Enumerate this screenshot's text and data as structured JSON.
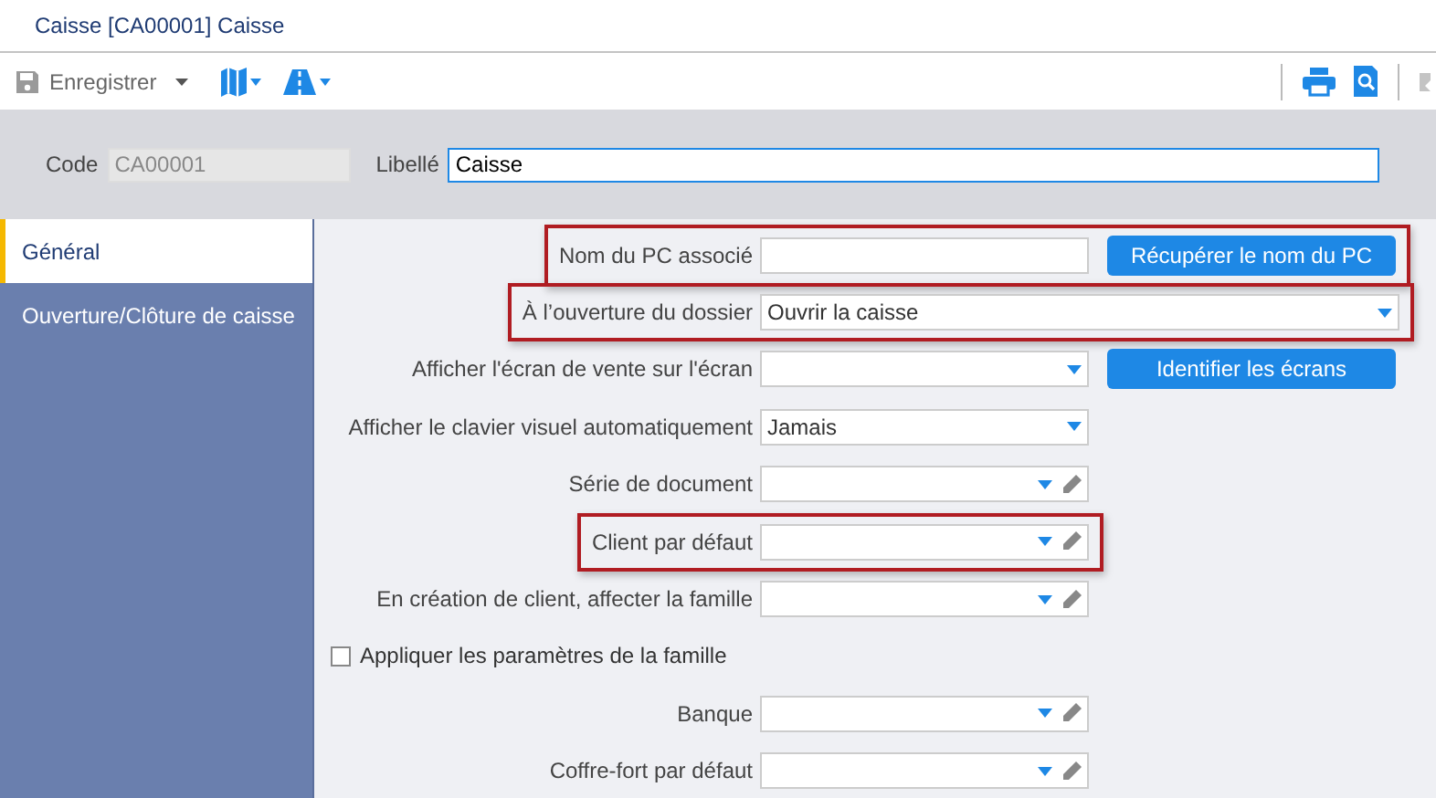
{
  "window": {
    "title": "Caisse [CA00001] Caisse"
  },
  "toolbar": {
    "save_label": "Enregistrer"
  },
  "header": {
    "code_label": "Code",
    "code_value": "CA00001",
    "libelle_label": "Libellé",
    "libelle_value": "Caisse"
  },
  "sidebar": {
    "items": [
      {
        "label": "Général",
        "selected": true
      },
      {
        "label": "Ouverture/Clôture de caisse",
        "selected": false
      }
    ]
  },
  "form": {
    "rows": [
      {
        "kind": "text",
        "label": "Nom du PC associé",
        "value": "",
        "button": "Récupérer le nom du PC",
        "highlighted": true
      },
      {
        "kind": "select-wide",
        "label": "À l’ouverture du dossier",
        "value": "Ouvrir la caisse",
        "highlighted": true
      },
      {
        "kind": "select",
        "label": "Afficher l'écran de vente sur l'écran",
        "value": "",
        "button": "Identifier les écrans",
        "highlighted": false
      },
      {
        "kind": "select",
        "label": "Afficher le clavier visuel automatiquement",
        "value": "Jamais",
        "highlighted": false
      },
      {
        "kind": "lookup",
        "label": "Série de document",
        "value": "",
        "highlighted": false
      },
      {
        "kind": "lookup",
        "label": "Client par défaut",
        "value": "",
        "highlighted": true
      },
      {
        "kind": "lookup",
        "label": "En création de client, affecter la famille",
        "value": "",
        "highlighted": false
      },
      {
        "kind": "checkbox",
        "label": "Appliquer les paramètres de la famille",
        "checked": false
      },
      {
        "kind": "lookup",
        "label": "Banque",
        "value": "",
        "highlighted": false
      },
      {
        "kind": "lookup",
        "label": "Coffre-fort par défaut",
        "value": "",
        "highlighted": false
      }
    ]
  }
}
